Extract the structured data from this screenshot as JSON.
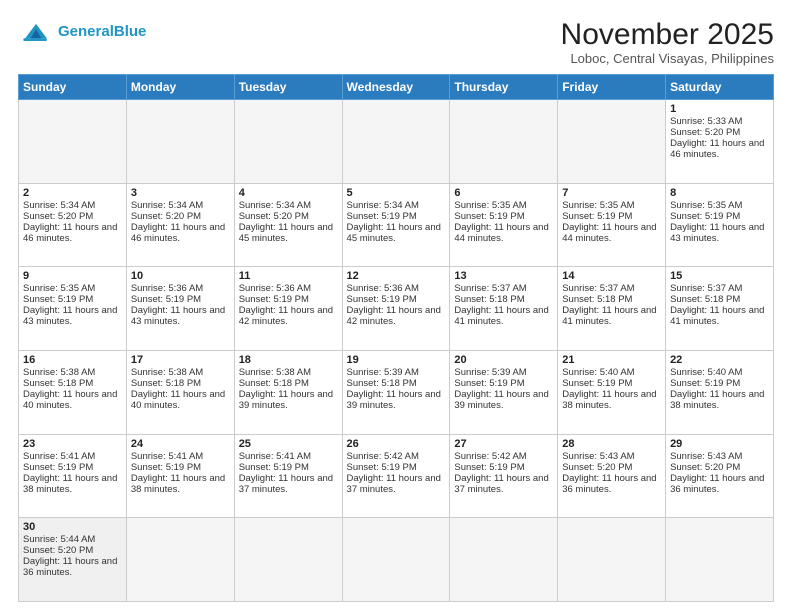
{
  "header": {
    "logo_general": "General",
    "logo_blue": "Blue",
    "month_title": "November 2025",
    "location": "Loboc, Central Visayas, Philippines"
  },
  "days_of_week": [
    "Sunday",
    "Monday",
    "Tuesday",
    "Wednesday",
    "Thursday",
    "Friday",
    "Saturday"
  ],
  "weeks": [
    [
      {
        "day": "",
        "sunrise": "",
        "sunset": "",
        "daylight": ""
      },
      {
        "day": "",
        "sunrise": "",
        "sunset": "",
        "daylight": ""
      },
      {
        "day": "",
        "sunrise": "",
        "sunset": "",
        "daylight": ""
      },
      {
        "day": "",
        "sunrise": "",
        "sunset": "",
        "daylight": ""
      },
      {
        "day": "",
        "sunrise": "",
        "sunset": "",
        "daylight": ""
      },
      {
        "day": "",
        "sunrise": "",
        "sunset": "",
        "daylight": ""
      },
      {
        "day": "1",
        "sunrise": "Sunrise: 5:33 AM",
        "sunset": "Sunset: 5:20 PM",
        "daylight": "Daylight: 11 hours and 46 minutes."
      }
    ],
    [
      {
        "day": "2",
        "sunrise": "Sunrise: 5:34 AM",
        "sunset": "Sunset: 5:20 PM",
        "daylight": "Daylight: 11 hours and 46 minutes."
      },
      {
        "day": "3",
        "sunrise": "Sunrise: 5:34 AM",
        "sunset": "Sunset: 5:20 PM",
        "daylight": "Daylight: 11 hours and 46 minutes."
      },
      {
        "day": "4",
        "sunrise": "Sunrise: 5:34 AM",
        "sunset": "Sunset: 5:20 PM",
        "daylight": "Daylight: 11 hours and 45 minutes."
      },
      {
        "day": "5",
        "sunrise": "Sunrise: 5:34 AM",
        "sunset": "Sunset: 5:19 PM",
        "daylight": "Daylight: 11 hours and 45 minutes."
      },
      {
        "day": "6",
        "sunrise": "Sunrise: 5:35 AM",
        "sunset": "Sunset: 5:19 PM",
        "daylight": "Daylight: 11 hours and 44 minutes."
      },
      {
        "day": "7",
        "sunrise": "Sunrise: 5:35 AM",
        "sunset": "Sunset: 5:19 PM",
        "daylight": "Daylight: 11 hours and 44 minutes."
      },
      {
        "day": "8",
        "sunrise": "Sunrise: 5:35 AM",
        "sunset": "Sunset: 5:19 PM",
        "daylight": "Daylight: 11 hours and 43 minutes."
      }
    ],
    [
      {
        "day": "9",
        "sunrise": "Sunrise: 5:35 AM",
        "sunset": "Sunset: 5:19 PM",
        "daylight": "Daylight: 11 hours and 43 minutes."
      },
      {
        "day": "10",
        "sunrise": "Sunrise: 5:36 AM",
        "sunset": "Sunset: 5:19 PM",
        "daylight": "Daylight: 11 hours and 43 minutes."
      },
      {
        "day": "11",
        "sunrise": "Sunrise: 5:36 AM",
        "sunset": "Sunset: 5:19 PM",
        "daylight": "Daylight: 11 hours and 42 minutes."
      },
      {
        "day": "12",
        "sunrise": "Sunrise: 5:36 AM",
        "sunset": "Sunset: 5:19 PM",
        "daylight": "Daylight: 11 hours and 42 minutes."
      },
      {
        "day": "13",
        "sunrise": "Sunrise: 5:37 AM",
        "sunset": "Sunset: 5:18 PM",
        "daylight": "Daylight: 11 hours and 41 minutes."
      },
      {
        "day": "14",
        "sunrise": "Sunrise: 5:37 AM",
        "sunset": "Sunset: 5:18 PM",
        "daylight": "Daylight: 11 hours and 41 minutes."
      },
      {
        "day": "15",
        "sunrise": "Sunrise: 5:37 AM",
        "sunset": "Sunset: 5:18 PM",
        "daylight": "Daylight: 11 hours and 41 minutes."
      }
    ],
    [
      {
        "day": "16",
        "sunrise": "Sunrise: 5:38 AM",
        "sunset": "Sunset: 5:18 PM",
        "daylight": "Daylight: 11 hours and 40 minutes."
      },
      {
        "day": "17",
        "sunrise": "Sunrise: 5:38 AM",
        "sunset": "Sunset: 5:18 PM",
        "daylight": "Daylight: 11 hours and 40 minutes."
      },
      {
        "day": "18",
        "sunrise": "Sunrise: 5:38 AM",
        "sunset": "Sunset: 5:18 PM",
        "daylight": "Daylight: 11 hours and 39 minutes."
      },
      {
        "day": "19",
        "sunrise": "Sunrise: 5:39 AM",
        "sunset": "Sunset: 5:18 PM",
        "daylight": "Daylight: 11 hours and 39 minutes."
      },
      {
        "day": "20",
        "sunrise": "Sunrise: 5:39 AM",
        "sunset": "Sunset: 5:19 PM",
        "daylight": "Daylight: 11 hours and 39 minutes."
      },
      {
        "day": "21",
        "sunrise": "Sunrise: 5:40 AM",
        "sunset": "Sunset: 5:19 PM",
        "daylight": "Daylight: 11 hours and 38 minutes."
      },
      {
        "day": "22",
        "sunrise": "Sunrise: 5:40 AM",
        "sunset": "Sunset: 5:19 PM",
        "daylight": "Daylight: 11 hours and 38 minutes."
      }
    ],
    [
      {
        "day": "23",
        "sunrise": "Sunrise: 5:41 AM",
        "sunset": "Sunset: 5:19 PM",
        "daylight": "Daylight: 11 hours and 38 minutes."
      },
      {
        "day": "24",
        "sunrise": "Sunrise: 5:41 AM",
        "sunset": "Sunset: 5:19 PM",
        "daylight": "Daylight: 11 hours and 38 minutes."
      },
      {
        "day": "25",
        "sunrise": "Sunrise: 5:41 AM",
        "sunset": "Sunset: 5:19 PM",
        "daylight": "Daylight: 11 hours and 37 minutes."
      },
      {
        "day": "26",
        "sunrise": "Sunrise: 5:42 AM",
        "sunset": "Sunset: 5:19 PM",
        "daylight": "Daylight: 11 hours and 37 minutes."
      },
      {
        "day": "27",
        "sunrise": "Sunrise: 5:42 AM",
        "sunset": "Sunset: 5:19 PM",
        "daylight": "Daylight: 11 hours and 37 minutes."
      },
      {
        "day": "28",
        "sunrise": "Sunrise: 5:43 AM",
        "sunset": "Sunset: 5:20 PM",
        "daylight": "Daylight: 11 hours and 36 minutes."
      },
      {
        "day": "29",
        "sunrise": "Sunrise: 5:43 AM",
        "sunset": "Sunset: 5:20 PM",
        "daylight": "Daylight: 11 hours and 36 minutes."
      }
    ],
    [
      {
        "day": "30",
        "sunrise": "Sunrise: 5:44 AM",
        "sunset": "Sunset: 5:20 PM",
        "daylight": "Daylight: 11 hours and 36 minutes."
      },
      {
        "day": "",
        "sunrise": "",
        "sunset": "",
        "daylight": ""
      },
      {
        "day": "",
        "sunrise": "",
        "sunset": "",
        "daylight": ""
      },
      {
        "day": "",
        "sunrise": "",
        "sunset": "",
        "daylight": ""
      },
      {
        "day": "",
        "sunrise": "",
        "sunset": "",
        "daylight": ""
      },
      {
        "day": "",
        "sunrise": "",
        "sunset": "",
        "daylight": ""
      },
      {
        "day": "",
        "sunrise": "",
        "sunset": "",
        "daylight": ""
      }
    ]
  ]
}
